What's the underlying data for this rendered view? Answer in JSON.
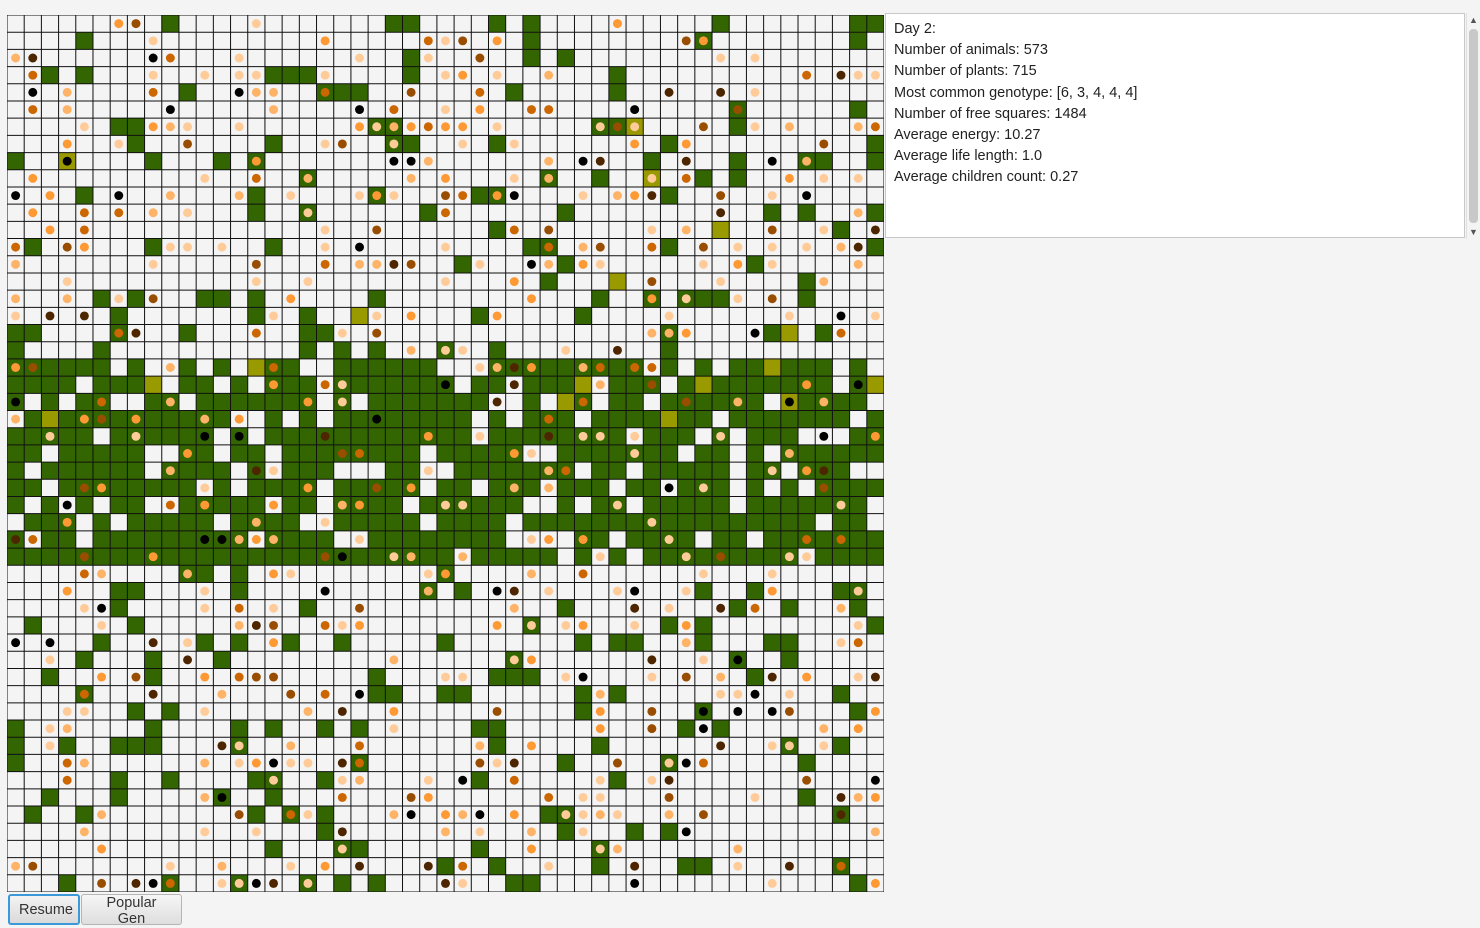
{
  "stats": {
    "day": "Day 2:",
    "animals": "Number of animals: 573",
    "plants": "Number of plants: 715",
    "genotype": "Most common genotype: [6, 3, 4, 4, 4]",
    "free_squares": "Number of free squares: 1484",
    "avg_energy": "Average energy: 10.27",
    "avg_life": "Average life length: 1.0",
    "avg_children": "Average children count: 0.27"
  },
  "buttons": {
    "resume": "Resume",
    "popular_gen": "Popular Gen"
  },
  "map": {
    "columns": 51,
    "rows": 51,
    "jungle_rows": [
      20,
      31
    ],
    "colors": {
      "empty": "#f4f4f4",
      "grid_line": "#111111",
      "plant": "#336600",
      "highlight": "#999900",
      "animal_shades": [
        "#ffcc99",
        "#ffb366",
        "#ff9933",
        "#cc6600",
        "#994d00",
        "#4d2600",
        "#000000"
      ]
    },
    "steppe_plant_density": 0.12,
    "jungle_plant_density": 0.78,
    "animal_density": 0.22
  }
}
